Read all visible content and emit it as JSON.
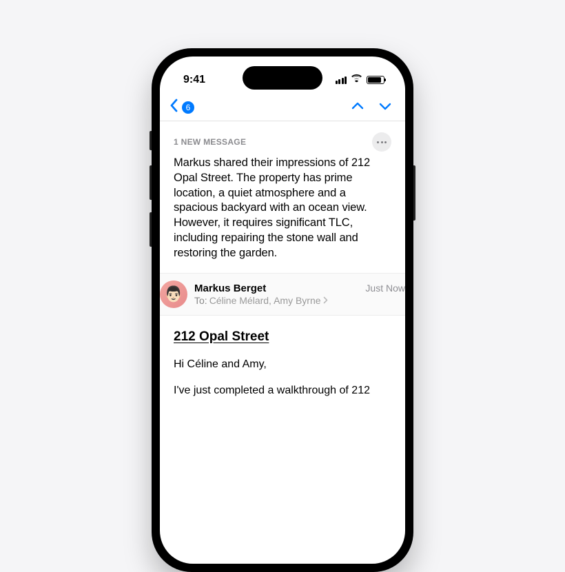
{
  "status_bar": {
    "time": "9:41"
  },
  "nav": {
    "back_badge": "6"
  },
  "summary": {
    "label": "1 NEW MESSAGE",
    "text": "Markus shared their impressions of 212 Opal Street. The property has prime location, a quiet atmosphere and a spacious backyard with an ocean view. However, it requires significant TLC, including repairing the stone wall and restoring the garden."
  },
  "message": {
    "sender_name": "Markus Berget",
    "timestamp": "Just Now",
    "to_label": "To:",
    "recipients": "Céline Mélard, Amy Byrne",
    "avatar_emoji": "👨🏻"
  },
  "email": {
    "subject": "212 Opal Street",
    "greeting": "Hi Céline and Amy,",
    "body_line": "I've just completed a walkthrough of 212"
  }
}
